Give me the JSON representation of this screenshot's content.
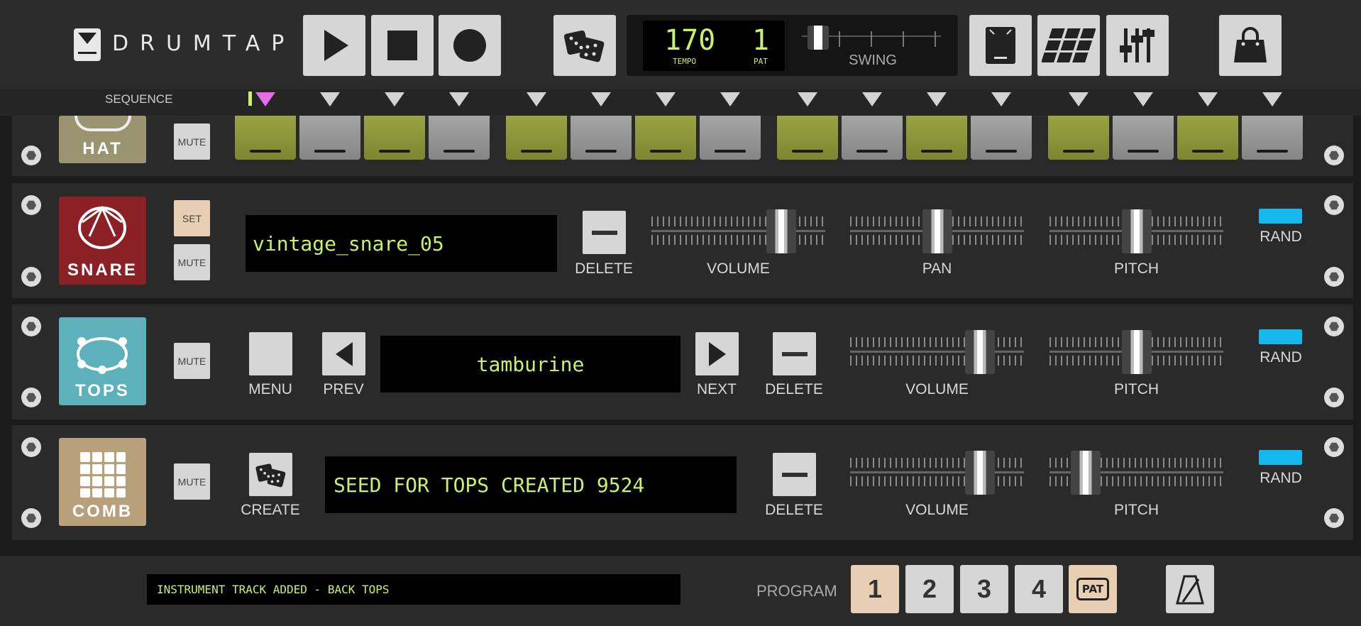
{
  "app": {
    "name": "DRUMTAP"
  },
  "transport": {
    "tempo": "170",
    "tempo_label": "TEMPO",
    "pattern": "1",
    "pattern_label": "PAT",
    "swing_label": "SWING",
    "swing_level": 0.05
  },
  "sequence": {
    "label": "SEQUENCE",
    "playhead_step": 1
  },
  "tracks": {
    "hat": {
      "name": "HAT",
      "mute": "MUTE",
      "steps": [
        1,
        0,
        1,
        0,
        1,
        0,
        1,
        0,
        1,
        0,
        1,
        0,
        1,
        0,
        1,
        0
      ]
    },
    "snare": {
      "name": "SNARE",
      "set": "SET",
      "mute": "MUTE",
      "sample": "vintage_snare_05",
      "delete": "DELETE",
      "volume": "VOLUME",
      "pan": "PAN",
      "pitch": "PITCH",
      "rand": "RAND",
      "volume_level": 0.8,
      "pan_level": 0.5,
      "pitch_level": 0.5
    },
    "tops": {
      "name": "TOPS",
      "mute": "MUTE",
      "menu": "MENU",
      "prev": "PREV",
      "sample": "tamburine",
      "next": "NEXT",
      "delete": "DELETE",
      "volume": "VOLUME",
      "pitch": "PITCH",
      "rand": "RAND",
      "volume_level": 0.8,
      "pitch_level": 0.5
    },
    "comb": {
      "name": "COMB",
      "mute": "MUTE",
      "create": "CREATE",
      "seed_text": "SEED FOR TOPS CREATED 9524",
      "delete": "DELETE",
      "volume": "VOLUME",
      "pitch": "PITCH",
      "rand": "RAND",
      "volume_level": 0.8,
      "pitch_level": 0.15
    }
  },
  "status": {
    "message": "INSTRUMENT TRACK ADDED - BACK TOPS"
  },
  "program": {
    "label": "PROGRAM",
    "slots": [
      "1",
      "2",
      "3",
      "4"
    ],
    "selected": "1",
    "pat_label": "PAT"
  },
  "colors": {
    "accent_green": "#c9f26a",
    "step_on": "#8f9838",
    "rand_blue": "#14b8ee",
    "snare": "#8b2125",
    "tops": "#5cb1bb",
    "comb": "#b8a07a",
    "hat": "#9a9471",
    "selected": "#e8cfb3"
  },
  "icons": [
    "logo-icon",
    "play-icon",
    "stop-icon",
    "record-icon",
    "dice-icon",
    "phone-icon",
    "grid-icon",
    "mixer-icon",
    "bag-icon",
    "metronome-icon",
    "pattern-loop-icon"
  ]
}
